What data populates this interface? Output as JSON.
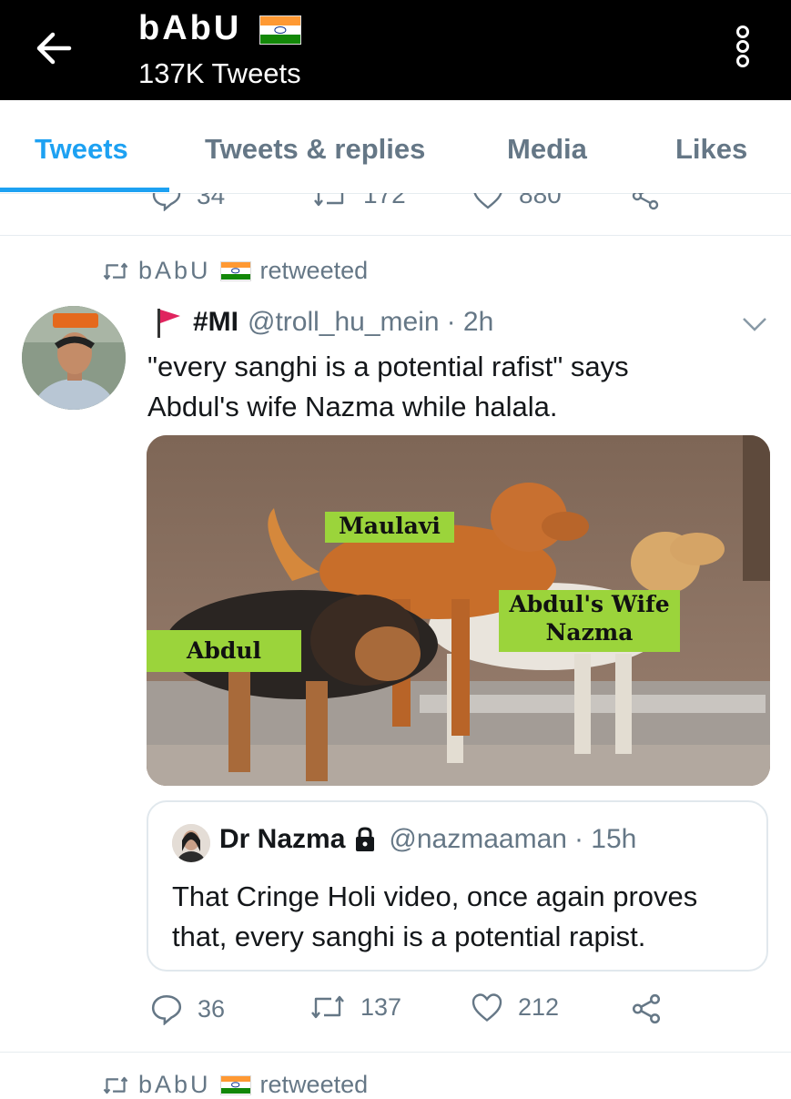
{
  "header": {
    "title": "bAbU",
    "subtitle": "137K Tweets"
  },
  "tabs": [
    {
      "label": "Tweets",
      "active": true
    },
    {
      "label": "Tweets & replies",
      "active": false
    },
    {
      "label": "Media",
      "active": false
    },
    {
      "label": "Likes",
      "active": false
    }
  ],
  "previous_tweet": {
    "replies": "34",
    "retweets": "172",
    "likes": "880"
  },
  "retweet_context": {
    "user": "bAbU",
    "label": "retweeted"
  },
  "tweet": {
    "name": "#MI",
    "handle": "@troll_hu_mein",
    "time": "· 2h",
    "text_line1": "\"every sanghi is a potential rafist\" says",
    "text_line2": "Abdul's wife Nazma while halala.",
    "meme_labels": {
      "label1": "Maulavi",
      "label2_line1": "Abdul's Wife",
      "label2_line2": "Nazma",
      "label3": "Abdul"
    },
    "quoted": {
      "name": "Dr Nazma",
      "handle": "@nazmaaman",
      "time": "· 15h",
      "text_line1": "That Cringe Holi video, once again proves",
      "text_line2": "that, every sanghi is a potential rapist."
    },
    "replies": "36",
    "retweets": "137",
    "likes": "212"
  },
  "next_retweet_context": {
    "user": "bAbU",
    "label": "retweeted"
  },
  "colors": {
    "accent": "#1da1f2",
    "secondary_text": "#657786",
    "meme_label_bg": "#9bd43b"
  },
  "icons": [
    "back-arrow-icon",
    "more-icon",
    "india-flag-icon",
    "retweet-icon",
    "red-flag-icon",
    "chevron-down-icon",
    "lock-icon",
    "reply-icon",
    "like-icon",
    "share-icon"
  ]
}
